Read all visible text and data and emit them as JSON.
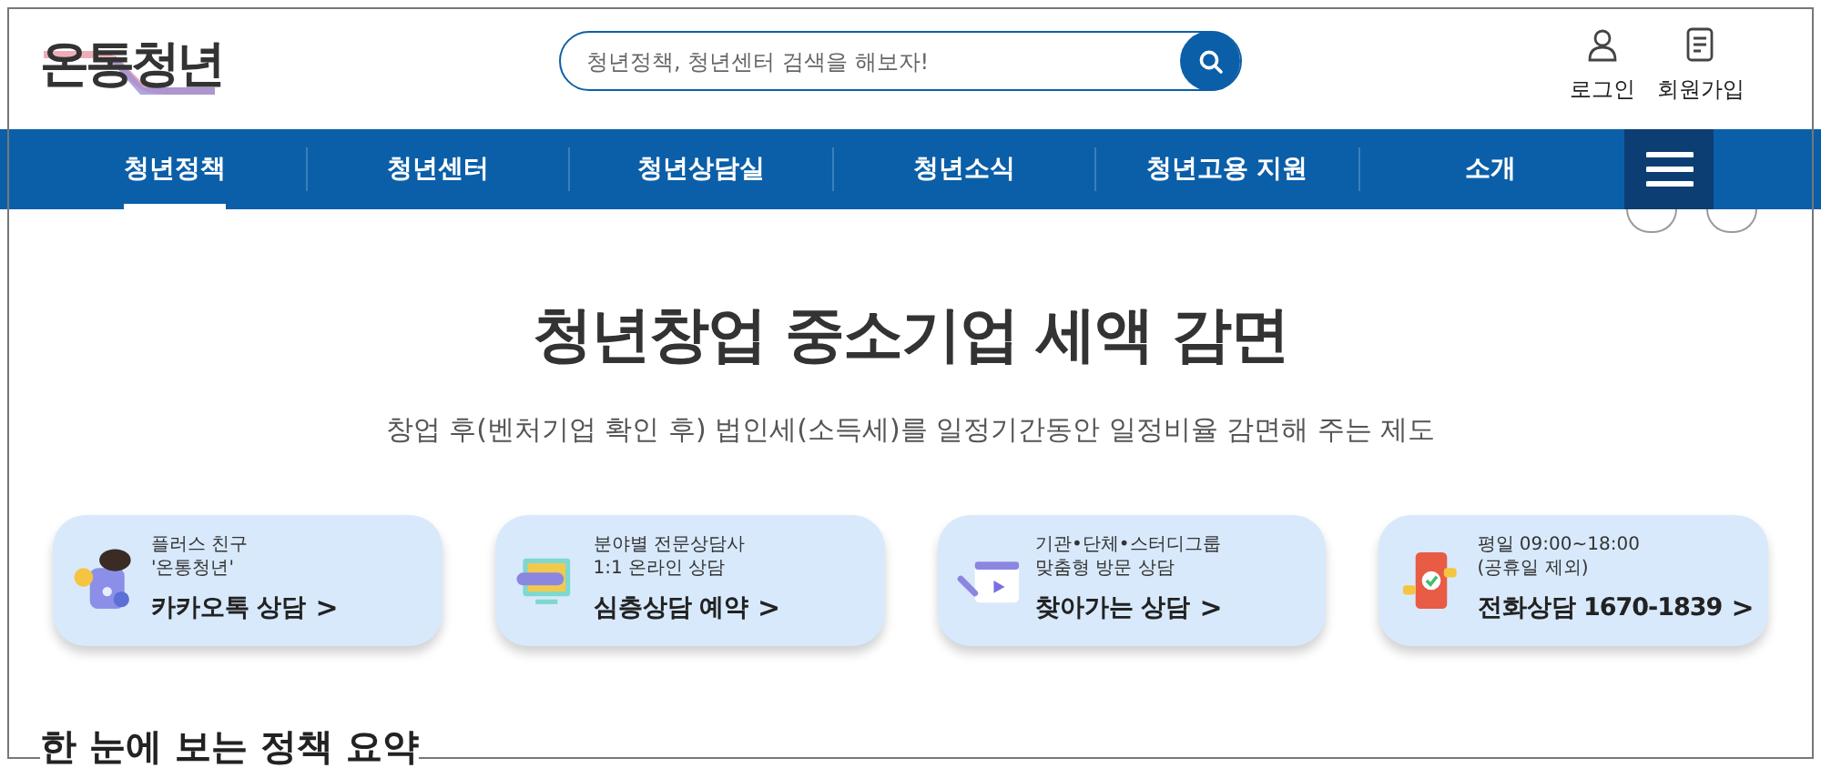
{
  "logo": {
    "text": "온통청년"
  },
  "search": {
    "placeholder": "청년정책, 청년센터 검색을 해보자!"
  },
  "user_links": [
    {
      "kind": "login",
      "label": "로그인"
    },
    {
      "kind": "join",
      "label": "회원가입"
    }
  ],
  "nav": {
    "items": [
      {
        "label": "청년정책",
        "selected": true
      },
      {
        "label": "청년센터",
        "selected": false
      },
      {
        "label": "청년상담실",
        "selected": false
      },
      {
        "label": "청년소식",
        "selected": false
      },
      {
        "label": "청년고용 지원",
        "selected": false
      },
      {
        "label": "소개",
        "selected": false
      }
    ]
  },
  "hero": {
    "title": "청년창업 중소기업 세액 감면",
    "subtitle": "창업 후(벤처기업 확인 후) 법인세(소득세)를 일정기간동안 일정비율 감면해 주는 제도"
  },
  "consult_cards": [
    {
      "kind": "kakao",
      "lines": [
        "플러스 친구",
        "'온통청년'"
      ],
      "label": "카카오톡 상담",
      "arrow": ">"
    },
    {
      "kind": "online",
      "lines": [
        "분야별 전문상담사",
        "1:1 온라인 상담"
      ],
      "label": "심층상담 예약",
      "arrow": ">"
    },
    {
      "kind": "visit",
      "lines": [
        "기관•단체•스터디그룹",
        "맞춤형 방문 상담"
      ],
      "label": "찾아가는 상담",
      "arrow": ">"
    },
    {
      "kind": "phone",
      "lines": [
        "평일 09:00~18:00",
        "(공휴일 제외)"
      ],
      "label": "전화상담 1670-1839",
      "arrow": ">"
    }
  ],
  "next_section": {
    "title": "한 눈에 보는 정책 요약"
  }
}
